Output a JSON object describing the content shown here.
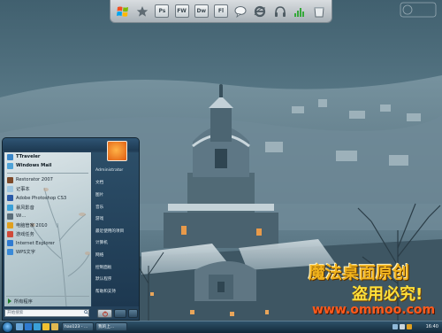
{
  "dock": {
    "icons": [
      "windows-flag-icon",
      "star-icon",
      "photoshop-icon",
      "fireworks-icon",
      "dreamweaver-icon",
      "flash-icon",
      "chat-icon",
      "ie-icon",
      "headphones-icon",
      "equalizer-icon",
      "recycle-bin-icon"
    ],
    "labels": [
      "Ps",
      "FW",
      "Dw",
      "Fl"
    ]
  },
  "top_watermark": "",
  "start_menu": {
    "pinned": [
      "TTraveler",
      "Windows Mail"
    ],
    "programs": [
      "Restorator 2007",
      "记事本",
      "Adobe Photoshop CS3",
      "暴风影音",
      "Wi...",
      "电脑管家 2010",
      "游戏任务",
      "Internet Explorer",
      "WPS文字"
    ],
    "all_programs": "所有程序",
    "search_placeholder": "开始搜索",
    "right_items": [
      "Administrator",
      "文档",
      "图片",
      "音乐",
      "游戏",
      "最近使用的项目",
      "计算机",
      "网络",
      "控制面板",
      "默认程序",
      "帮助和支持"
    ],
    "power_label": "",
    "colors": {
      "accent": "#24415a",
      "panel_light": "#dde6e9"
    }
  },
  "taskbar": {
    "tasks": [
      "hao123 - ...",
      "我的上..."
    ],
    "clock": "16:40"
  },
  "watermarks": {
    "line1": "魔法桌面原创",
    "line2": "盗用必究!",
    "line3": "www.ommoo.com"
  }
}
